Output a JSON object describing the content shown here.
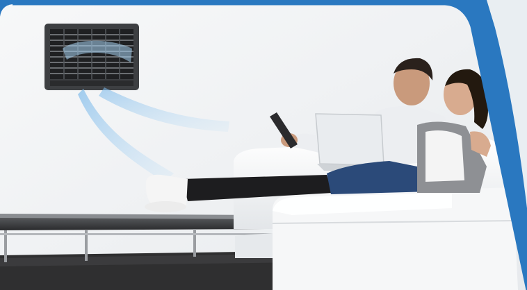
{
  "colors": {
    "frame_blue": "#2a78c0",
    "wall": "#f1f3f5",
    "sofa": "#fafafa",
    "vent": "#3d3f42",
    "airflow": "#8cc3ea",
    "rug": "#2f2f30"
  },
  "icons": {
    "vent": "air-vent-grille",
    "airflow": "cool-air-stream",
    "remote": "tv-remote",
    "laptop": "laptop"
  }
}
